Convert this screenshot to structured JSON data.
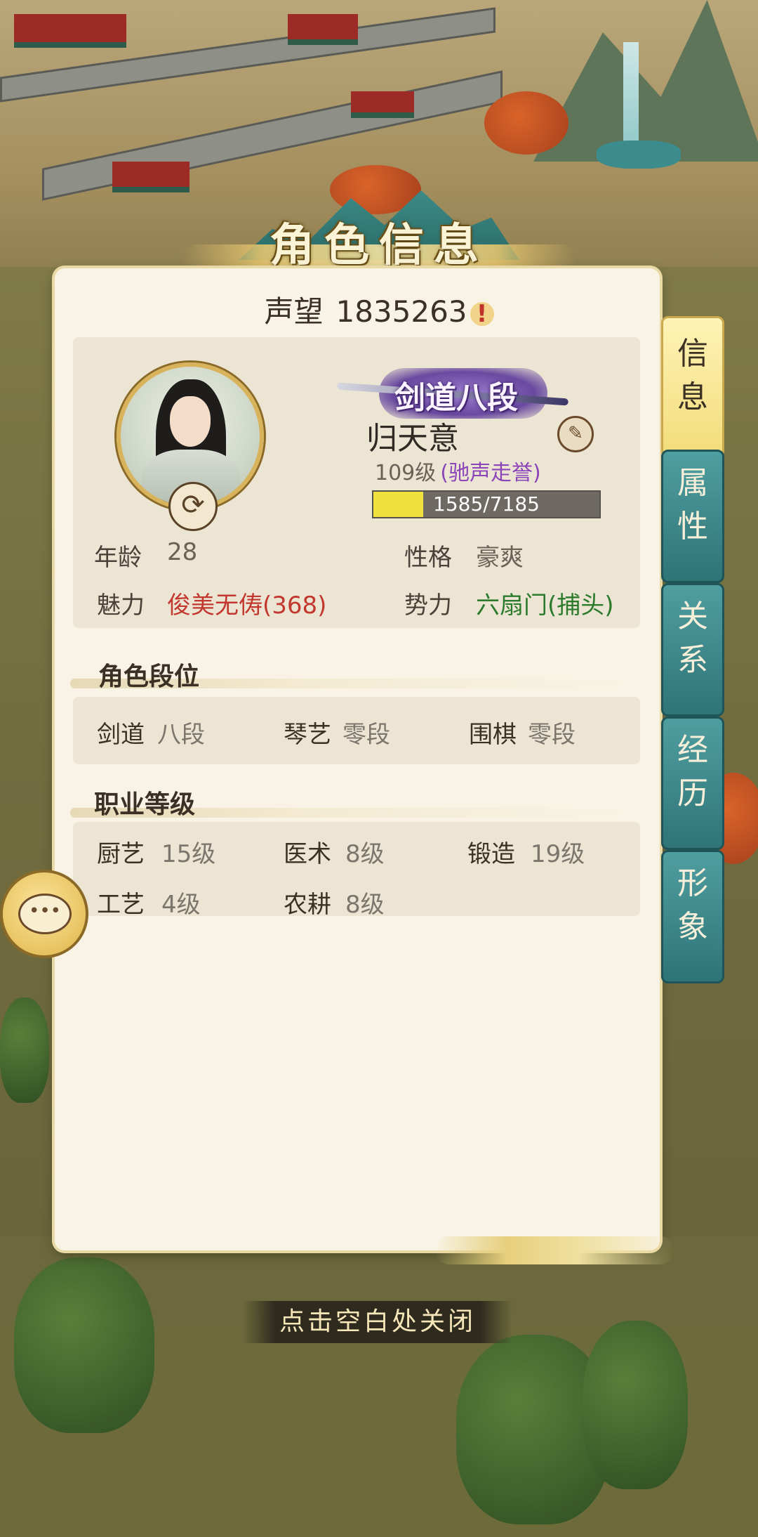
{
  "title": "角色信息",
  "reputation": {
    "label": "声望",
    "value": "1835263",
    "alert": "!"
  },
  "character": {
    "rank_badge": "剑道八段",
    "name": "归天意",
    "level": "109级",
    "level_title": "(驰声走誉)",
    "xp_text": "1585/7185",
    "xp_fraction": 0.2206,
    "swap_icon": "swap-arrows-icon",
    "edit_icon": "brush-icon"
  },
  "stats": {
    "age_label": "年龄",
    "age_value": "28",
    "personality_label": "性格",
    "personality_value": "豪爽",
    "charm_label": "魅力",
    "charm_value": "俊美无俦(368)",
    "faction_label": "势力",
    "faction_value": "六扇门(捕头)"
  },
  "ranks_section": {
    "title": "角色段位",
    "items": [
      {
        "label": "剑道",
        "value": "八段"
      },
      {
        "label": "琴艺",
        "value": "零段"
      },
      {
        "label": "围棋",
        "value": "零段"
      }
    ]
  },
  "jobs_section": {
    "title": "职业等级",
    "items": [
      {
        "label": "厨艺",
        "value": "15级"
      },
      {
        "label": "医术",
        "value": "8级"
      },
      {
        "label": "锻造",
        "value": "19级"
      },
      {
        "label": "工艺",
        "value": "4级"
      },
      {
        "label": "农耕",
        "value": "8级"
      }
    ]
  },
  "tabs": [
    {
      "line1": "信",
      "line2": "息",
      "active": true
    },
    {
      "line1": "属",
      "line2": "性",
      "active": false
    },
    {
      "line1": "关",
      "line2": "系",
      "active": false
    },
    {
      "line1": "经",
      "line2": "历",
      "active": false
    },
    {
      "line1": "形",
      "line2": "象",
      "active": false
    }
  ],
  "close_hint": "点击空白处关闭",
  "colors": {
    "charm": "#c2372e",
    "faction": "#2c7a2c",
    "level_title": "#8b45b8",
    "tab_teal": "#2f7477",
    "tab_active": "#f2dc7a",
    "xp_fill": "#f0e23d"
  }
}
